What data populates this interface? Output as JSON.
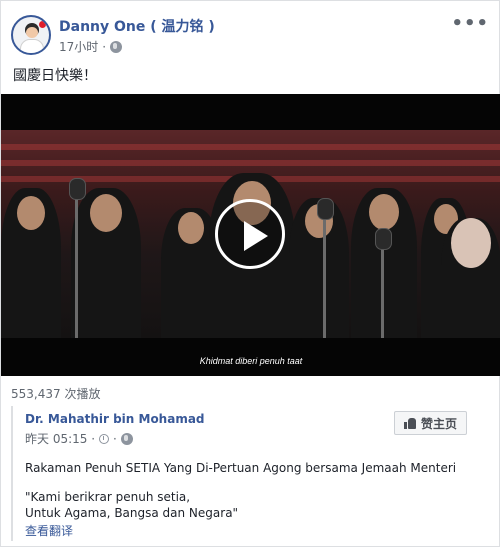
{
  "post": {
    "author_name": "Danny One ( 温力铭 )",
    "time": "17小时",
    "text": "國慶日快樂！",
    "more_icon": "ellipsis-icon",
    "privacy_icon": "globe-icon"
  },
  "video": {
    "subtitle": "Khidmat diberi penuh taat",
    "play_icon": "play-icon",
    "views": "553,437 次播放"
  },
  "shared_post": {
    "author_name": "Dr. Mahathir bin Mohamad",
    "time": "昨天 05:15 · ",
    "like_page_label": "赞主页",
    "description": "Rakaman Penuh SETIA Yang Di-Pertuan Agong bersama Jemaah Menteri",
    "quote_line1": "\"Kami berikrar penuh setia,",
    "quote_line2": "Untuk Agama, Bangsa dan Negara\"",
    "see_translation": "查看翻译"
  },
  "colors": {
    "link": "#385898",
    "secondary_text": "#606770",
    "border": "#dddfe2"
  }
}
